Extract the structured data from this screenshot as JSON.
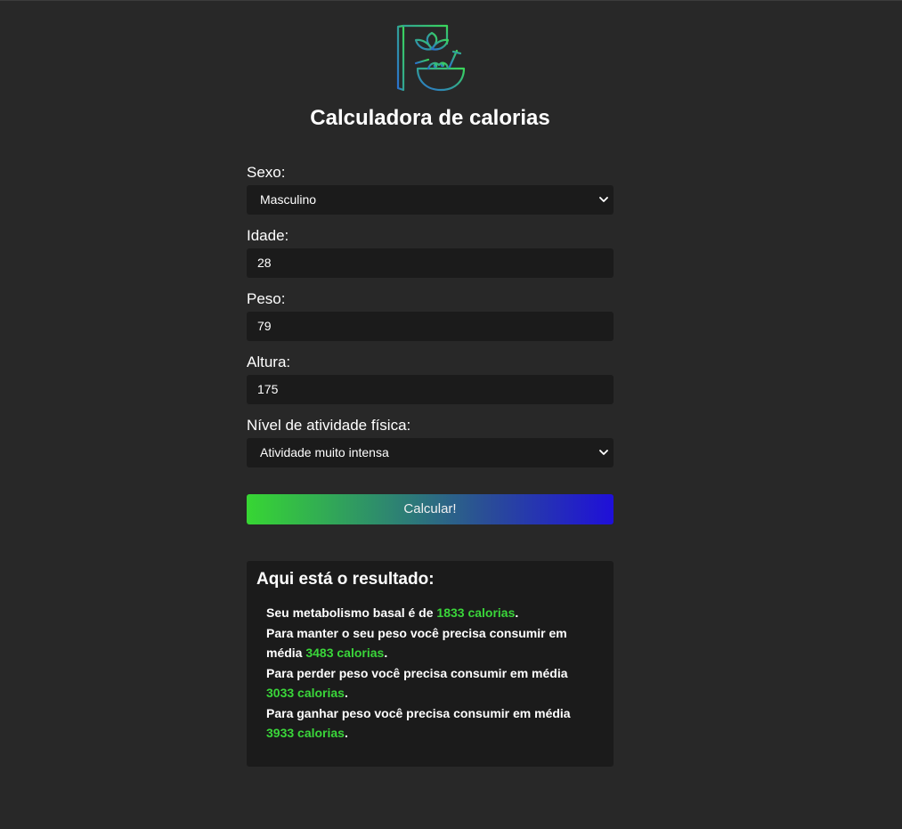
{
  "header": {
    "logo_icon": "food-book-bowl-icon",
    "title": "Calculadora de calorias"
  },
  "form": {
    "sexo": {
      "label": "Sexo:",
      "value": "Masculino"
    },
    "idade": {
      "label": "Idade:",
      "value": "28"
    },
    "peso": {
      "label": "Peso:",
      "value": "79"
    },
    "altura": {
      "label": "Altura:",
      "value": "175"
    },
    "atividade": {
      "label": "Nível de atividade física:",
      "value": "Atividade muito intensa"
    },
    "submit_label": "Calcular!"
  },
  "result": {
    "title": "Aqui está o resultado:",
    "line1_pre": "Seu metabolismo basal é de ",
    "basal": "1833 calorias",
    "line1_post": ".",
    "line2_pre": "Para manter o seu peso você precisa consumir em média ",
    "manter": "3483 calorias",
    "line2_post": ".",
    "line3_pre": "Para perder peso você precisa consumir em média ",
    "perder": "3033 calorias",
    "line3_post": ".",
    "line4_pre": "Para ganhar peso você precisa consumir em média ",
    "ganhar": "3933 calorias",
    "line4_post": "."
  },
  "colors": {
    "background": "#282828",
    "field_bg": "#1b1b1b",
    "accent_green": "#3ad63a",
    "accent_blue": "#1f0fd9"
  }
}
